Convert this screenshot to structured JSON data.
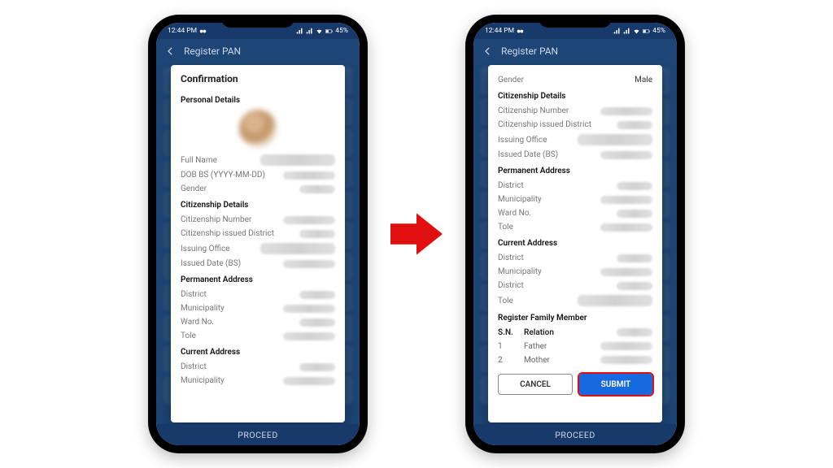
{
  "status": {
    "time": "12:44 PM",
    "battery": "45%"
  },
  "appbar": {
    "title": "Register PAN"
  },
  "footer": {
    "proceed": "PROCEED"
  },
  "dialog": {
    "title": "Confirmation",
    "cancel": "CANCEL",
    "submit": "SUBMIT",
    "sections": {
      "personal": {
        "heading": "Personal Details",
        "full_name": "Full Name",
        "dob": "DOB BS (YYYY-MM-DD)",
        "gender": "Gender",
        "gender_value": "Male"
      },
      "citizenship": {
        "heading": "Citizenship Details",
        "number": "Citizenship Number",
        "issued_district": "Citizenship issued District",
        "issuing_office": "Issuing Office",
        "issued_date": "Issued Date (BS)"
      },
      "permanent": {
        "heading": "Permanent Address",
        "district": "District",
        "municipality": "Municipality",
        "ward": "Ward No.",
        "tole": "Tole"
      },
      "current": {
        "heading": "Current Address",
        "district": "District",
        "municipality": "Municipality",
        "ward": "District",
        "tole": "Tole"
      },
      "family": {
        "heading": "Register Family Member",
        "columns": {
          "sn": "S.N.",
          "relation": "Relation"
        },
        "rows": [
          {
            "sn": "1",
            "relation": "Father"
          },
          {
            "sn": "2",
            "relation": "Mother"
          }
        ]
      }
    }
  }
}
